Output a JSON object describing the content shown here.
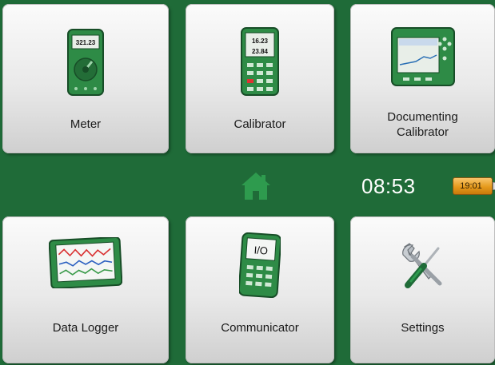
{
  "menu": {
    "tiles": [
      {
        "label": "Meter"
      },
      {
        "label": "Calibrator"
      },
      {
        "label_line1": "Documenting",
        "label_line2": "Calibrator"
      },
      {
        "label": "Data Logger"
      },
      {
        "label": "Communicator"
      },
      {
        "label": "Settings"
      }
    ]
  },
  "icons": {
    "meter_reading": "321.23",
    "calibrator_reading_top": "16.23",
    "calibrator_reading_bottom": "23.84",
    "communicator_screen": "I/O"
  },
  "status_bar": {
    "time": "08:53",
    "battery_time": "19:01"
  },
  "colors": {
    "background": "#1f6b38",
    "device_green": "#2e8b46",
    "home_icon": "#2e9b4e",
    "battery": "#e59a1c"
  }
}
